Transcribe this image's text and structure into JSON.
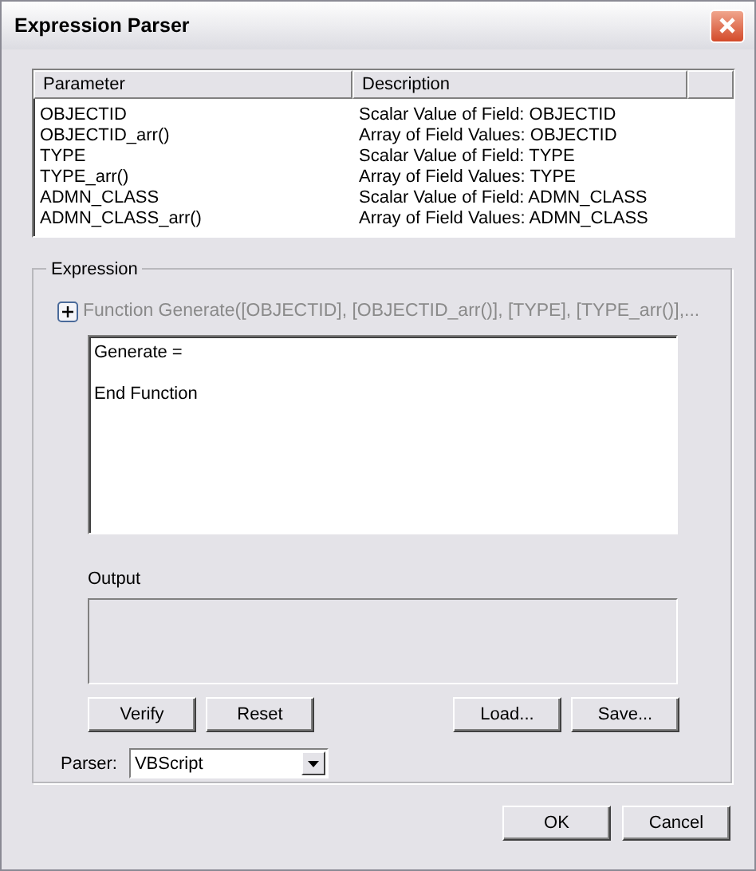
{
  "window": {
    "title": "Expression Parser"
  },
  "parameters": {
    "columns": [
      "Parameter",
      "Description"
    ],
    "rows": [
      [
        "OBJECTID",
        "Scalar Value of Field: OBJECTID"
      ],
      [
        "OBJECTID_arr()",
        "Array of Field Values: OBJECTID"
      ],
      [
        "TYPE",
        "Scalar Value of Field: TYPE"
      ],
      [
        "TYPE_arr()",
        "Array of Field Values: TYPE"
      ],
      [
        "ADMN_CLASS",
        "Scalar Value of Field: ADMN_CLASS"
      ],
      [
        "ADMN_CLASS_arr()",
        "Array of Field Values: ADMN_CLASS"
      ]
    ]
  },
  "expression": {
    "title": "Expression",
    "function_header": "Function Generate([OBJECTID], [OBJECTID_arr()], [TYPE], [TYPE_arr()],...",
    "code": "Generate =\n\nEnd Function",
    "output_label": "Output",
    "buttons": [
      "Verify",
      "Reset",
      "Load...",
      "Save..."
    ],
    "parser_label": "Parser:",
    "parser_value": "VBScript"
  },
  "buttons": [
    "OK",
    "Cancel"
  ]
}
